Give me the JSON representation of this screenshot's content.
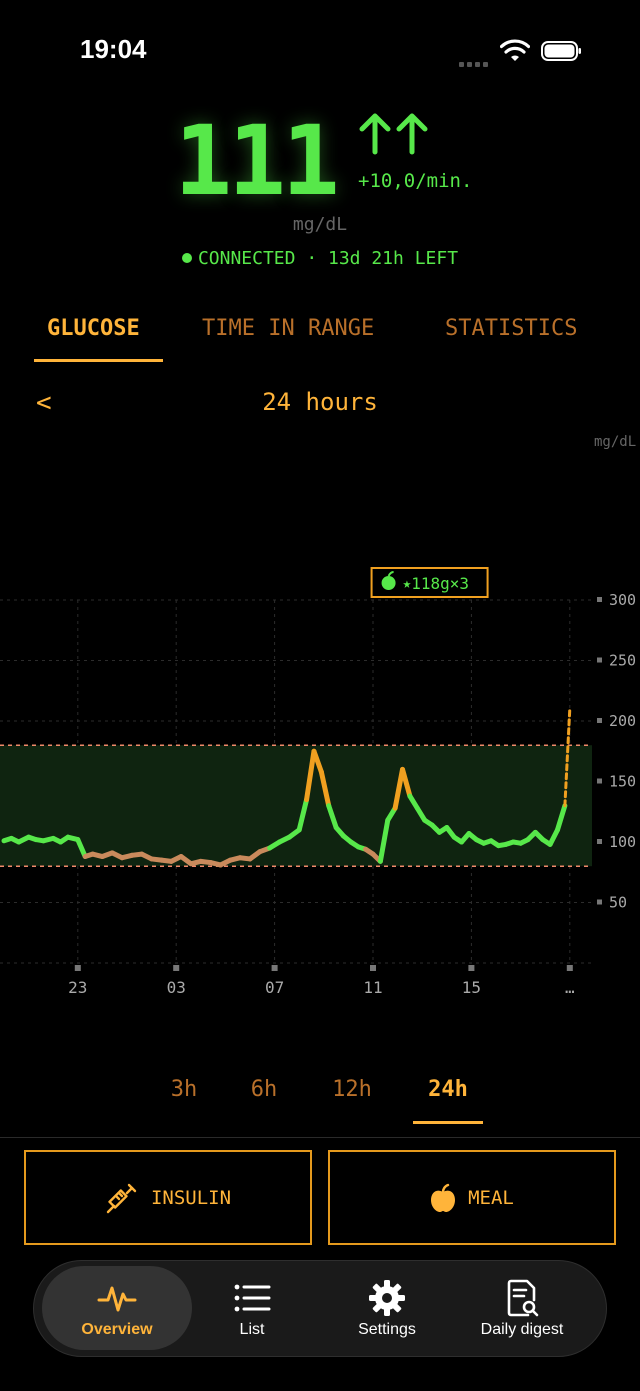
{
  "status_bar": {
    "time": "19:04"
  },
  "reading": {
    "value": "111",
    "rate": "+10,0/min.",
    "unit": "mg/dL",
    "connection_status": "CONNECTED",
    "sensor_left": "· 13d 21h LEFT"
  },
  "tabs": [
    {
      "label": "GLUCOSE",
      "active": true
    },
    {
      "label": "TIME IN RANGE",
      "active": false
    },
    {
      "label": "STATISTICS",
      "active": false
    }
  ],
  "range": {
    "back_label": "<",
    "title": "24 hours",
    "axis_unit": "mg/dL"
  },
  "chart_data": {
    "type": "line",
    "x_tick_labels": [
      "23",
      "03",
      "07",
      "11",
      "15",
      "…"
    ],
    "y_tick_labels": [
      "50",
      "100",
      "150",
      "200",
      "250",
      "300"
    ],
    "ylim": [
      0,
      300
    ],
    "target_range": [
      80,
      180
    ],
    "annotations": [
      {
        "label": "⭑118g×3",
        "x_hour": 13.3
      }
    ],
    "series": [
      {
        "x_hours": [
          20.0,
          20.3,
          20.6,
          21.0,
          21.3,
          21.6,
          22.0,
          22.3,
          22.6,
          23.0,
          23.3,
          23.6,
          0.0,
          0.4,
          0.8,
          1.2,
          1.6,
          2.0,
          2.4,
          2.8,
          3.2,
          3.6,
          4.0,
          4.4,
          4.8,
          5.2,
          5.6,
          6.0,
          6.4,
          6.8,
          7.2,
          7.6,
          8.0,
          8.3,
          8.6,
          8.9,
          9.2,
          9.5,
          9.8,
          10.1,
          10.4,
          10.7,
          11.0,
          11.3,
          11.6,
          11.9,
          12.2,
          12.5,
          12.8,
          13.1,
          13.4,
          13.7,
          14.0,
          14.3,
          14.6,
          14.9,
          15.2,
          15.5,
          15.8,
          16.1,
          16.4,
          16.7,
          17.0,
          17.3,
          17.6,
          17.9,
          18.2,
          18.5,
          18.8,
          19.0
        ],
        "values": [
          101,
          103,
          100,
          104,
          102,
          101,
          103,
          100,
          104,
          102,
          88,
          90,
          88,
          91,
          87,
          89,
          90,
          86,
          85,
          84,
          88,
          82,
          84,
          83,
          81,
          85,
          87,
          86,
          92,
          95,
          100,
          104,
          110,
          135,
          175,
          158,
          130,
          112,
          105,
          100,
          96,
          94,
          90,
          84,
          118,
          128,
          160,
          138,
          128,
          118,
          114,
          108,
          112,
          104,
          100,
          107,
          102,
          99,
          101,
          97,
          98,
          100,
          99,
          102,
          108,
          102,
          98,
          110,
          130,
          210
        ]
      }
    ]
  },
  "periods": [
    {
      "label": "3h",
      "active": false
    },
    {
      "label": "6h",
      "active": false
    },
    {
      "label": "12h",
      "active": false
    },
    {
      "label": "24h",
      "active": true
    }
  ],
  "actions": {
    "insulin_label": "INSULIN",
    "meal_label": "MEAL"
  },
  "nav": [
    {
      "label": "Overview",
      "icon": "pulse-icon",
      "active": true
    },
    {
      "label": "List",
      "icon": "list-icon",
      "active": false
    },
    {
      "label": "Settings",
      "icon": "gear-icon",
      "active": false
    },
    {
      "label": "Daily digest",
      "icon": "document-search-icon",
      "active": false
    }
  ],
  "colors": {
    "accent": "#ffb43a",
    "glucose_green": "#57e84a",
    "low_brown": "#c98a5c",
    "high_orange": "#f0a020",
    "range_fill": "#0f2410",
    "limit_line": "#f08a6a"
  }
}
